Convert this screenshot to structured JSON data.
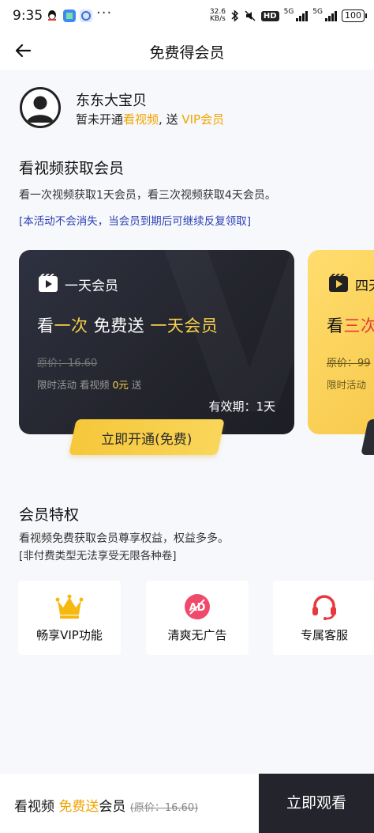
{
  "status_bar": {
    "time": "9:35",
    "net_speed_top": "32.6",
    "net_speed_bottom": "KB/s",
    "hd": "HD",
    "signal1": "5G",
    "signal2": "5G",
    "battery": "100",
    "more": "···"
  },
  "nav": {
    "title": "免费得会员"
  },
  "profile": {
    "username": "东东大宝贝",
    "status_prefix": "暂未开通",
    "status_link": "看视频",
    "status_mid": ", 送 ",
    "status_vip": "VIP会员"
  },
  "watch_section": {
    "title": "看视频获取会员",
    "description": "看一次视频获取1天会员，看三次视频获取4天会员。",
    "note": "[本活动不会消失，当会员到期后可继续反复领取]"
  },
  "cards": [
    {
      "name": "一天会员",
      "headline_a": "看",
      "headline_b": "一次",
      "headline_c": " 免费送 ",
      "headline_d": "一天会员",
      "original_price": "原价：16.60",
      "sub_a": "限时活动 看视频 ",
      "sub_b": "0元",
      "sub_c": " 送",
      "validity": "有效期：1天",
      "button": "立即开通(免费)"
    },
    {
      "name": "四天",
      "headline_a": "看",
      "headline_b": "三次",
      "original_price": "原价：99",
      "sub_a": "限时活动"
    }
  ],
  "privileges": {
    "title": "会员特权",
    "description": "看视频免费获取会员尊享权益，权益多多。",
    "note": "[非付费类型无法享受无限各种卷]",
    "items": [
      {
        "label": "畅享VIP功能",
        "icon": "crown-icon"
      },
      {
        "label": "清爽无广告",
        "icon": "ad-free-icon"
      },
      {
        "label": "专属客服",
        "icon": "headset-icon"
      }
    ]
  },
  "bottom_bar": {
    "text_a": "看视频 ",
    "text_b": "免费送",
    "text_c": "会员 ",
    "original_price": "(原价：16.60)",
    "button": "立即观看"
  },
  "colors": {
    "gold": "#f0a400",
    "yellow": "#f8d04a",
    "dark_card": "#23242c",
    "note_blue": "#2b3fb5",
    "red": "#e8383d"
  }
}
